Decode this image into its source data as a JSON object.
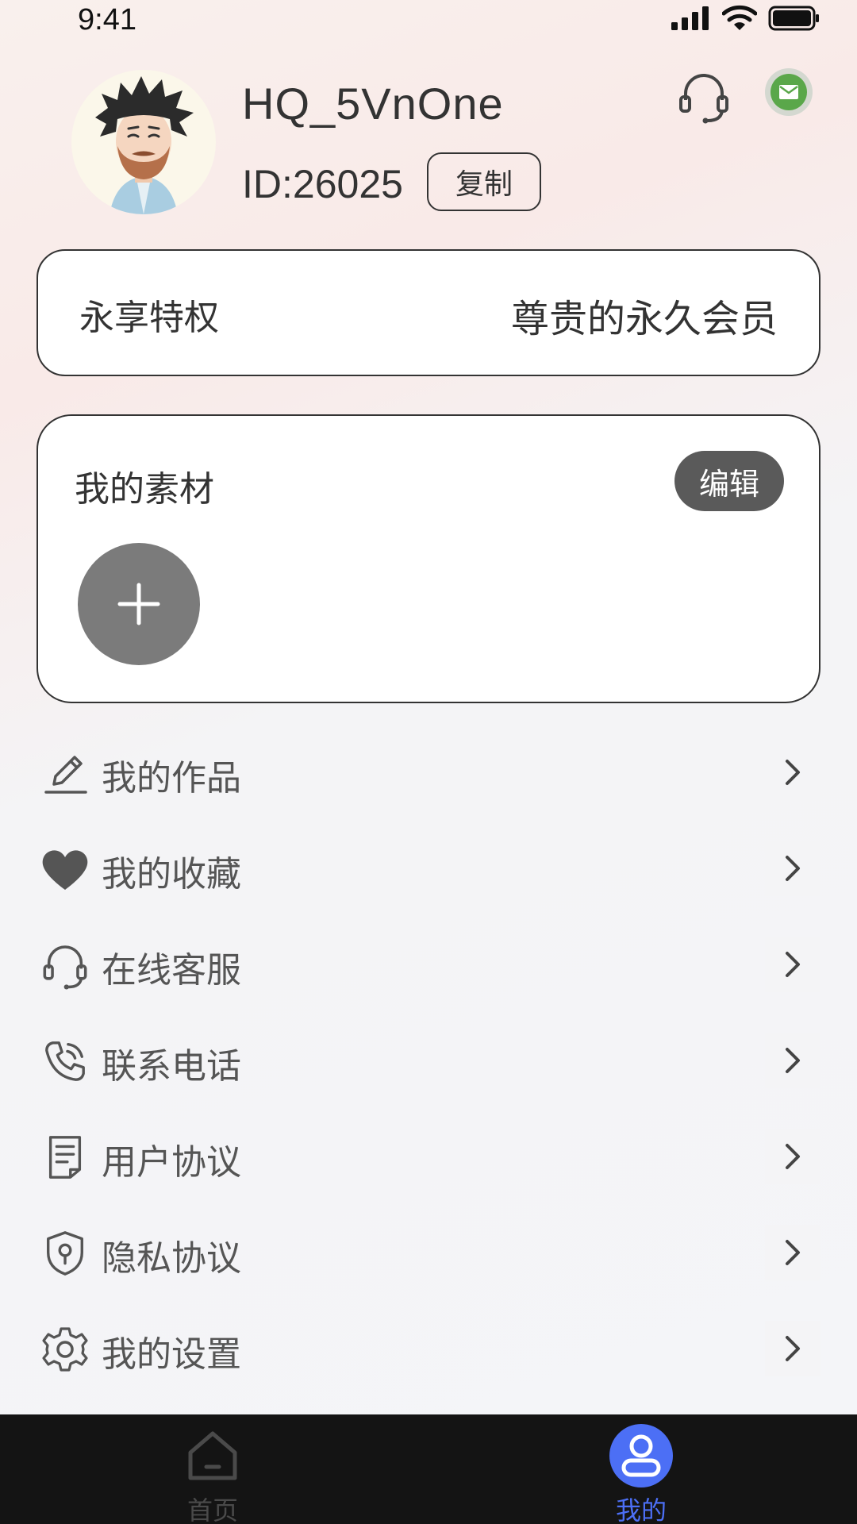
{
  "status_bar": {
    "time": "9:41"
  },
  "profile": {
    "username": "HQ_5VnOne",
    "user_id": "ID:26025",
    "copy_label": "复制"
  },
  "vip": {
    "label": "永享特权",
    "value": "尊贵的永久会员"
  },
  "materials": {
    "title": "我的素材",
    "edit_label": "编辑"
  },
  "menu": [
    {
      "label": "我的作品",
      "icon": "pencil-icon"
    },
    {
      "label": "我的收藏",
      "icon": "heart-icon"
    },
    {
      "label": "在线客服",
      "icon": "headset-icon"
    },
    {
      "label": "联系电话",
      "icon": "phone-icon"
    },
    {
      "label": "用户协议",
      "icon": "document-icon"
    },
    {
      "label": "隐私协议",
      "icon": "shield-icon"
    },
    {
      "label": "我的设置",
      "icon": "gear-icon"
    }
  ],
  "tabs": [
    {
      "label": "首页",
      "icon": "home-icon",
      "active": false
    },
    {
      "label": "我的",
      "icon": "user-icon",
      "active": true
    }
  ],
  "colors": {
    "tab_active": "#4c6ff5",
    "tab_bar_bg": "#141414",
    "edit_button_bg": "#5a5a5a",
    "add_button_bg": "#7b7b7b",
    "message_icon_green": "#5aa74a"
  }
}
